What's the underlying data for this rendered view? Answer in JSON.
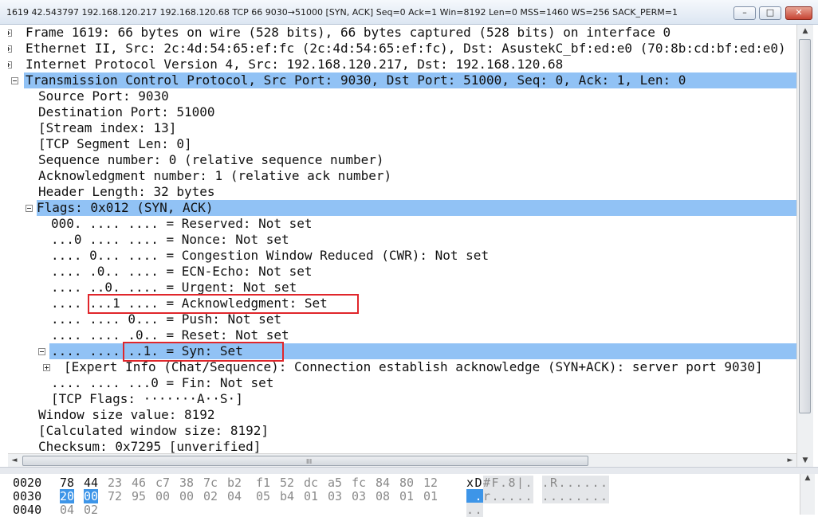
{
  "window": {
    "title": "1619 42.543797 192.168.120.217 192.168.120.68 TCP 66 9030→51000 [SYN, ACK] Seq=0 Ack=1 Win=8192 Len=0 MSS=1460 WS=256 SACK_PERM=1",
    "minimize_label": "–",
    "maximize_label": "□",
    "close_label": "✕"
  },
  "tree": [
    {
      "text": "Frame 1619: 66 bytes on wire (528 bits), 66 bytes captured (528 bits) on interface 0",
      "expander": "plus",
      "selected": false
    },
    {
      "text": "Ethernet II, Src: 2c:4d:54:65:ef:fc (2c:4d:54:65:ef:fc), Dst: AsustekC_bf:ed:e0 (70:8b:cd:bf:ed:e0)",
      "expander": "plus",
      "selected": false
    },
    {
      "text": "Internet Protocol Version 4, Src: 192.168.120.217, Dst: 192.168.120.68",
      "expander": "plus",
      "selected": false
    },
    {
      "text": "Transmission Control Protocol, Src Port: 9030, Dst Port: 51000, Seq: 0, Ack: 1, Len: 0",
      "expander": "minus",
      "selected": true
    },
    {
      "text": "Source Port: 9030",
      "expander": "none",
      "selected": false
    },
    {
      "text": "Destination Port: 51000",
      "expander": "none",
      "selected": false
    },
    {
      "text": "[Stream index: 13]",
      "expander": "none",
      "selected": false
    },
    {
      "text": "[TCP Segment Len: 0]",
      "expander": "none",
      "selected": false
    },
    {
      "text": "Sequence number: 0    (relative sequence number)",
      "expander": "none",
      "selected": false
    },
    {
      "text": "Acknowledgment number: 1    (relative ack number)",
      "expander": "none",
      "selected": false
    },
    {
      "text": "Header Length: 32 bytes",
      "expander": "none",
      "selected": false
    },
    {
      "text": "Flags: 0x012 (SYN, ACK)",
      "expander": "minus",
      "selected": true
    },
    {
      "text": "000. .... .... = Reserved: Not set",
      "expander": "none",
      "selected": false
    },
    {
      "text": "...0 .... .... = Nonce: Not set",
      "expander": "none",
      "selected": false
    },
    {
      "text": ".... 0... .... = Congestion Window Reduced (CWR): Not set",
      "expander": "none",
      "selected": false
    },
    {
      "text": ".... .0.. .... = ECN-Echo: Not set",
      "expander": "none",
      "selected": false
    },
    {
      "text": ".... ..0. .... = Urgent: Not set",
      "expander": "none",
      "selected": false
    },
    {
      "text": ".... ...1 .... = Acknowledgment: Set",
      "expander": "none",
      "selected": false
    },
    {
      "text": ".... .... 0... = Push: Not set",
      "expander": "none",
      "selected": false
    },
    {
      "text": ".... .... .0.. = Reset: Not set",
      "expander": "none",
      "selected": false
    },
    {
      "text": ".... .... ..1. = Syn: Set",
      "expander": "minus",
      "selected": true
    },
    {
      "text": "[Expert Info (Chat/Sequence): Connection establish acknowledge (SYN+ACK): server port 9030]",
      "expander": "plus",
      "selected": false
    },
    {
      "text": ".... .... ...0 = Fin: Not set",
      "expander": "none",
      "selected": false
    },
    {
      "text": "[TCP Flags: ·······A··S·]",
      "expander": "none",
      "selected": false
    },
    {
      "text": "Window size value: 8192",
      "expander": "none",
      "selected": false
    },
    {
      "text": "[Calculated window size: 8192]",
      "expander": "none",
      "selected": false
    },
    {
      "text": "Checksum: 0x7295 [unverified]",
      "expander": "none",
      "selected": false
    }
  ],
  "hex": [
    {
      "offset": "0020",
      "bytes": [
        "78",
        "44",
        "23",
        "46",
        "c7",
        "38",
        "7c",
        "b2",
        "f1",
        "52",
        "dc",
        "a5",
        "fc",
        "84",
        "80",
        "12"
      ],
      "byte_states": [
        "n",
        "n",
        "d",
        "d",
        "d",
        "d",
        "d",
        "d",
        "d",
        "d",
        "d",
        "d",
        "d",
        "d",
        "d",
        "d"
      ],
      "ascii": [
        "x",
        "D",
        "#",
        "F",
        ".",
        "8",
        "|",
        ".",
        ".",
        "R",
        ".",
        ".",
        ".",
        ".",
        ".",
        "."
      ],
      "ascii_states": [
        "n",
        "n",
        "d",
        "d",
        "d",
        "d",
        "d",
        "d",
        "d",
        "d",
        "d",
        "d",
        "d",
        "d",
        "d",
        "d"
      ]
    },
    {
      "offset": "0030",
      "bytes": [
        "20",
        "00",
        "72",
        "95",
        "00",
        "00",
        "02",
        "04",
        "05",
        "b4",
        "01",
        "03",
        "03",
        "08",
        "01",
        "01"
      ],
      "byte_states": [
        "s",
        "s",
        "d",
        "d",
        "d",
        "d",
        "d",
        "d",
        "d",
        "d",
        "d",
        "d",
        "d",
        "d",
        "d",
        "d"
      ],
      "ascii": [
        " ",
        ".",
        "r",
        ".",
        ".",
        ".",
        ".",
        ".",
        ".",
        ".",
        ".",
        ".",
        ".",
        ".",
        ".",
        "."
      ],
      "ascii_states": [
        "s",
        "s",
        "d",
        "d",
        "d",
        "d",
        "d",
        "d",
        "d",
        "d",
        "d",
        "d",
        "d",
        "d",
        "d",
        "d"
      ]
    },
    {
      "offset": "0040",
      "bytes": [
        "04",
        "02"
      ],
      "byte_states": [
        "d",
        "d"
      ],
      "ascii": [
        ".",
        "."
      ],
      "ascii_states": [
        "d",
        "d"
      ]
    }
  ],
  "scroll": {
    "up_arrow": "▲",
    "down_arrow": "▼",
    "left_arrow": "◄",
    "right_arrow": "►",
    "grip": "III"
  },
  "colors": {
    "selection": "#91c2f5",
    "byte_highlight": "#3d95e8",
    "annotation_box": "#e0262b"
  }
}
